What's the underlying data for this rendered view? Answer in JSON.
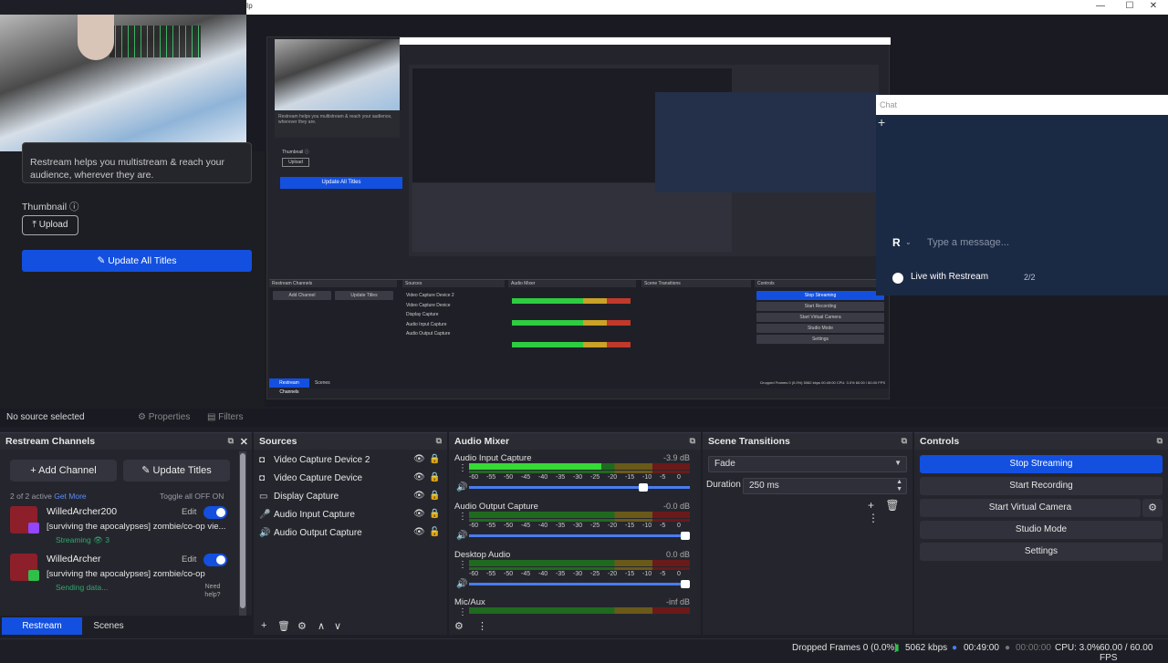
{
  "window": {
    "title_glyph": "Ip",
    "controls": [
      "—",
      "☐",
      "✕"
    ]
  },
  "restream_panel": {
    "description": "Restream helps you multistream & reach your audience, wherever they are.",
    "thumbnail_label": "Thumbnail ⓘ",
    "upload_label": "⤒  Upload",
    "update_all_label": "✎  Update All Titles"
  },
  "nested": {
    "desc": "Restream helps you multistream & reach your audience, wherever they are.",
    "thumbnail": "Thumbnail ⓘ",
    "upload": "Upload",
    "update_all": "Update All Titles",
    "docks": [
      "Restream Channels",
      "Sources",
      "Audio Mixer",
      "Scene Transitions",
      "Controls"
    ],
    "buttons": [
      "Add Channel",
      "Update Titles",
      "Stop Streaming",
      "Start Recording",
      "Start Virtual Camera",
      "Studio Mode",
      "Settings"
    ],
    "sources": [
      "Video Capture Device 2",
      "Video Capture Device",
      "Display Capture",
      "Audio Input Capture",
      "Audio Output Capture"
    ],
    "tabs": [
      "Restream Channels",
      "Scenes"
    ],
    "status": "Dropped Frames 0 (0.0%)   5062 kbps   00:49:00   CPU: 3.0%   60.00 / 60.00 FPS"
  },
  "chat": {
    "header": "Chat",
    "avatar_letter": "R",
    "placeholder": "Type a message...",
    "live_label": "Live with Restream",
    "viewer_count": "2/2"
  },
  "status_row": {
    "no_source": "No source selected",
    "properties": "⚙ Properties",
    "filters": "▤ Filters"
  },
  "restream_channels": {
    "title": "Restream Channels",
    "add_channel": "+  Add Channel",
    "update_titles": "✎  Update Titles",
    "active_info": "2 of 2 active",
    "get_more": "Get More",
    "toggle_all": "Toggle all OFF   ON",
    "channels": [
      {
        "name": "WilledArcher200",
        "edit": "Edit",
        "title": "[surviving the apocalypses] zombie/co-op vie...",
        "status": "Streaming   👁 3",
        "badge_color": "#9146ff"
      },
      {
        "name": "WilledArcher",
        "edit": "Edit",
        "title": "[surviving the apocalypses] zombie/co-op",
        "status": "Sending data...",
        "badge_color": "#2fbf4a"
      }
    ],
    "need_help": "Need help?"
  },
  "tabs": {
    "restream": "Restream Channels",
    "scenes": "Scenes"
  },
  "sources": {
    "title": "Sources",
    "items": [
      {
        "label": "Video Capture Device 2",
        "icon": "◘"
      },
      {
        "label": "Video Capture Device",
        "icon": "◘"
      },
      {
        "label": "Display Capture",
        "icon": "▭"
      },
      {
        "label": "Audio Input Capture",
        "icon": "🎤"
      },
      {
        "label": "Audio Output Capture",
        "icon": "🔊"
      }
    ],
    "toolbar": [
      "+",
      "🗑",
      "⚙",
      "∧",
      "∨"
    ]
  },
  "audio_mixer": {
    "title": "Audio Mixer",
    "scale": [
      "-60",
      "-55",
      "-50",
      "-45",
      "-40",
      "-35",
      "-30",
      "-25",
      "-20",
      "-15",
      "-10",
      "-5",
      "0"
    ],
    "channels": [
      {
        "name": "Audio Input Capture",
        "db": "-3.9 dB",
        "level": 0.6,
        "volume": 0.8
      },
      {
        "name": "Audio Output Capture",
        "db": "-0.0 dB",
        "level": 0.0,
        "volume": 1.0
      },
      {
        "name": "Desktop Audio",
        "db": "0.0 dB",
        "level": 0.0,
        "volume": 1.0
      },
      {
        "name": "Mic/Aux",
        "db": "-inf dB",
        "level": 0.0,
        "volume": 1.0
      }
    ]
  },
  "scene_transitions": {
    "title": "Scene Transitions",
    "transition": "Fade",
    "duration_label": "Duration",
    "duration_value": "250 ms"
  },
  "controls": {
    "title": "Controls",
    "stop_streaming": "Stop Streaming",
    "start_recording": "Start Recording",
    "start_virtual_camera": "Start Virtual Camera",
    "studio_mode": "Studio Mode",
    "settings": "Settings"
  },
  "statusbar": {
    "dropped_frames": "Dropped Frames 0 (0.0%)",
    "bitrate": "5062 kbps",
    "stream_time": "00:49:00",
    "rec_time": "00:00:00",
    "cpu": "CPU: 3.0%",
    "fps": "60.00 / 60.00 FPS"
  },
  "colors": {
    "accent": "#1350e0",
    "background": "#1e1f26",
    "meter_green": "#36d936"
  }
}
